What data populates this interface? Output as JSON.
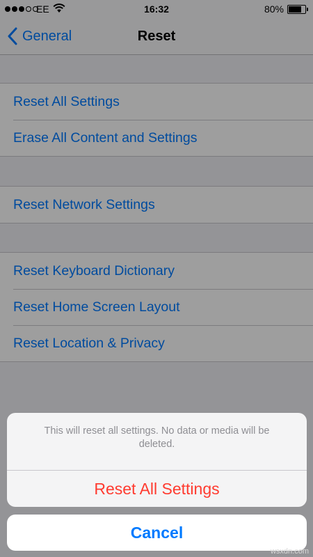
{
  "status_bar": {
    "signal_bars_filled": 3,
    "signal_bars_total": 5,
    "carrier": "EE",
    "wifi_icon": "wifi-icon",
    "time": "16:32",
    "battery_percent": "80%",
    "battery_level": 0.8
  },
  "nav": {
    "back_label": "General",
    "back_icon": "chevron-left-icon",
    "title": "Reset"
  },
  "groups": [
    {
      "items": [
        "Reset All Settings",
        "Erase All Content and Settings"
      ]
    },
    {
      "items": [
        "Reset Network Settings"
      ]
    },
    {
      "items": [
        "Reset Keyboard Dictionary",
        "Reset Home Screen Layout",
        "Reset Location & Privacy"
      ]
    }
  ],
  "action_sheet": {
    "message": "This will reset all settings. No data or media will be deleted.",
    "destructive_label": "Reset All Settings",
    "cancel_label": "Cancel"
  },
  "watermark": "wsxdn.com",
  "colors": {
    "accent": "#007aff",
    "destructive": "#ff3b30"
  }
}
